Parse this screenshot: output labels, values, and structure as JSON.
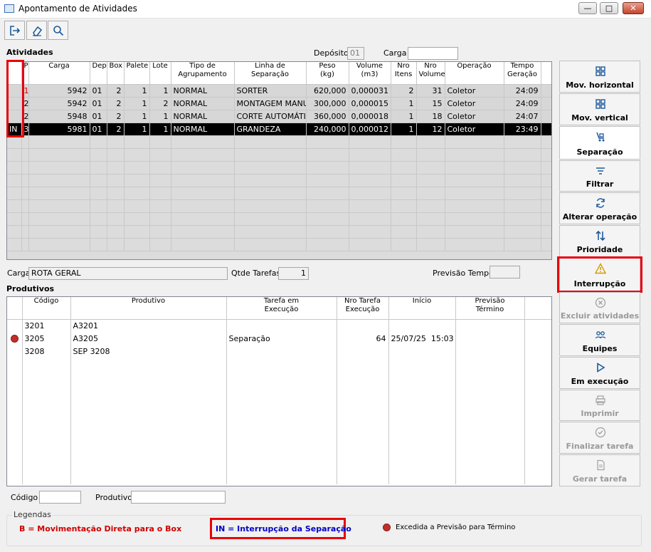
{
  "window": {
    "title": "Apontamento de Atividades",
    "btn_min": "—",
    "btn_max": "□",
    "btn_close": "✕"
  },
  "toolbar": {
    "icons": [
      "exit-icon",
      "eraser-icon",
      "search-icon"
    ]
  },
  "atividades": {
    "heading": "Atividades",
    "deposito_label": "Depósito",
    "deposito_value": "01",
    "carga_label": "Carga",
    "carga_value": "",
    "columns": [
      "",
      "P",
      "Carga",
      "Dep",
      "Box",
      "Palete",
      "Lote",
      "Tipo de\nAgrupamento",
      "Linha de\nSeparação",
      "Peso\n(kg)",
      "Volume\n(m3)",
      "Nro\nItens",
      "Nro\nVolume",
      "Operação",
      "Tempo\nGeração"
    ],
    "rows": [
      {
        "flag": "",
        "p": "1",
        "carga": "5942",
        "dep": "01",
        "box": "2",
        "palete": "1",
        "lote": "1",
        "tipo": "NORMAL",
        "linha": "SORTER",
        "peso": "620,000",
        "volume": "0,000031",
        "itens": "2",
        "nvol": "31",
        "operacao": "Coletor",
        "tempo": "24:09"
      },
      {
        "flag": "",
        "p": "2",
        "carga": "5942",
        "dep": "01",
        "box": "2",
        "palete": "1",
        "lote": "2",
        "tipo": "NORMAL",
        "linha": "MONTAGEM MANU",
        "peso": "300,000",
        "volume": "0,000015",
        "itens": "1",
        "nvol": "15",
        "operacao": "Coletor",
        "tempo": "24:09"
      },
      {
        "flag": "",
        "p": "2",
        "carga": "5948",
        "dep": "01",
        "box": "2",
        "palete": "1",
        "lote": "1",
        "tipo": "NORMAL",
        "linha": "CORTE AUTOMÁTI",
        "peso": "360,000",
        "volume": "0,000018",
        "itens": "1",
        "nvol": "18",
        "operacao": "Coletor",
        "tempo": "24:07"
      },
      {
        "flag": "IN",
        "p": "3",
        "carga": "5981",
        "dep": "01",
        "box": "2",
        "palete": "1",
        "lote": "1",
        "tipo": "NORMAL",
        "linha": "GRANDEZA",
        "peso": "240,000",
        "volume": "0,000012",
        "itens": "1",
        "nvol": "12",
        "operacao": "Coletor",
        "tempo": "23:49"
      }
    ]
  },
  "info": {
    "carga_label": "Carga",
    "carga_value": "ROTA GERAL",
    "qtde_label": "Qtde Tarefas",
    "qtde_value": "1",
    "previsao_label": "Previsão Tempo",
    "previsao_value": ""
  },
  "produtivos": {
    "heading": "Produtivos",
    "columns": [
      "",
      "Código",
      "Produtivo",
      "Tarefa em\nExecução",
      "Nro Tarefa\nExecução",
      "Início",
      "Previsão\nTérmino"
    ],
    "rows": [
      {
        "alert": false,
        "codigo": "3201",
        "produtivo": "A3201",
        "tarefa": "",
        "nro": "",
        "inicio": "",
        "previsao": ""
      },
      {
        "alert": true,
        "codigo": "3205",
        "produtivo": "A3205",
        "tarefa": "Separação",
        "nro": "64",
        "inicio": "25/07/25  15:03",
        "previsao": ""
      },
      {
        "alert": false,
        "codigo": "3208",
        "produtivo": "SEP 3208",
        "tarefa": "",
        "nro": "",
        "inicio": "",
        "previsao": ""
      }
    ]
  },
  "filters": {
    "codigo_label": "Código",
    "codigo_value": "",
    "produtivo_label": "Produtivo",
    "produtivo_value": ""
  },
  "side_buttons": [
    {
      "label": "Mov. horizontal",
      "icon": "move-horizontal-icon",
      "enabled": true
    },
    {
      "label": "Mov. vertical",
      "icon": "move-vertical-icon",
      "enabled": true
    },
    {
      "label": "Separação",
      "icon": "cart-icon",
      "enabled": true
    },
    {
      "label": "Filtrar",
      "icon": "filter-icon",
      "enabled": true
    },
    {
      "label": "Alterar operação",
      "icon": "refresh-icon",
      "enabled": true
    },
    {
      "label": "Prioridade",
      "icon": "sort-arrows-icon",
      "enabled": true
    },
    {
      "label": "Interrupção",
      "icon": "warning-icon",
      "enabled": true
    },
    {
      "label": "Excluir atividades",
      "icon": "delete-circle-icon",
      "enabled": false
    },
    {
      "label": "Equipes",
      "icon": "team-icon",
      "enabled": true
    },
    {
      "label": "Em execução",
      "icon": "play-icon",
      "enabled": true
    },
    {
      "label": "Imprimir",
      "icon": "printer-icon",
      "enabled": false
    },
    {
      "label": "Finalizar tarefa",
      "icon": "check-circle-icon",
      "enabled": false
    },
    {
      "label": "Gerar tarefa",
      "icon": "document-icon",
      "enabled": false
    }
  ],
  "legend": {
    "title": "Legendas",
    "item_b": "B = Movimentação Direta para o Box",
    "item_in": "IN = Interrupção da Separação",
    "item_dot": "Excedida a Previsão para Término"
  },
  "colors": {
    "highlight": "#e8000b",
    "selected_row": "#000000",
    "alert_dot": "#c0302b",
    "legend_blue": "#0000c8"
  }
}
